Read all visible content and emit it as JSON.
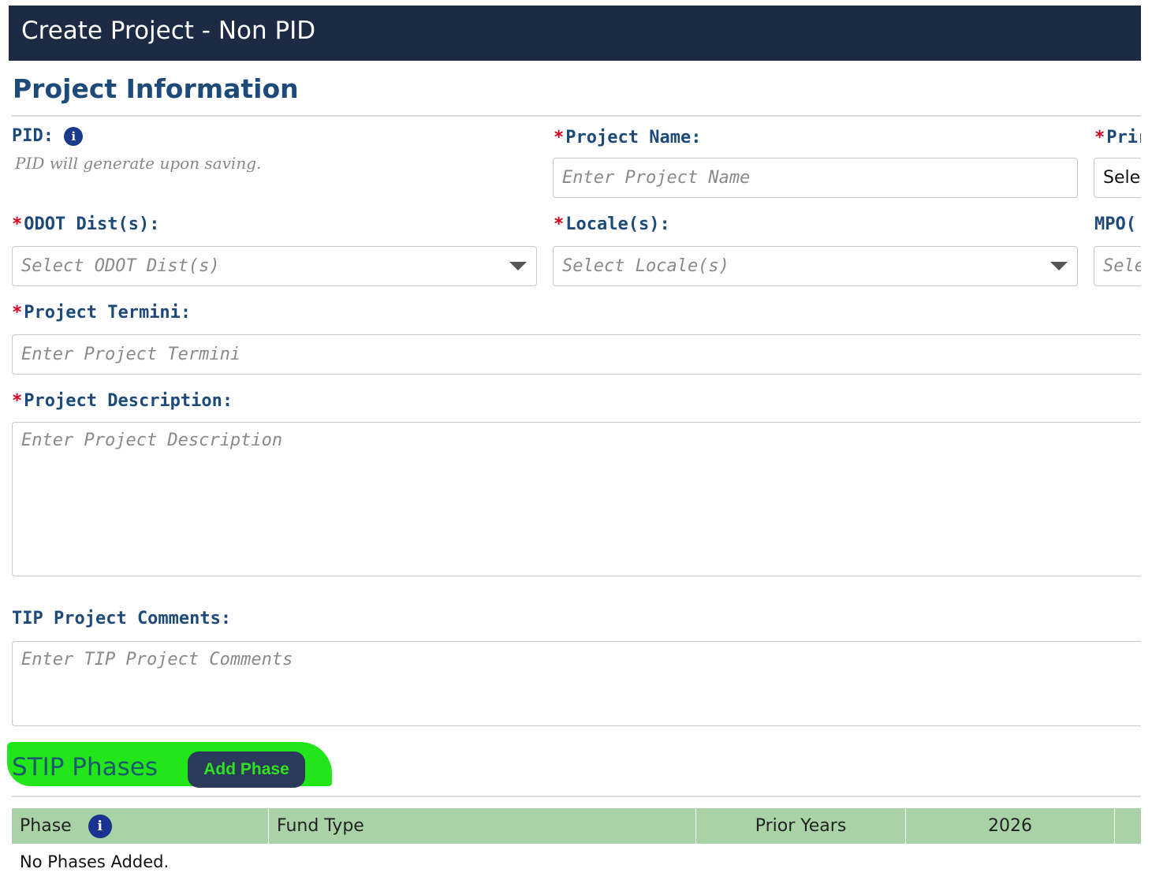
{
  "header": {
    "title": "Create Project - Non PID"
  },
  "project_info": {
    "section_title": "Project Information",
    "pid": {
      "label": "PID:",
      "hint": "PID will generate upon saving."
    },
    "project_name": {
      "label": "Project Name:",
      "placeholder": "Enter Project Name"
    },
    "prime": {
      "label_partial": "Prir",
      "value_partial": "Sele"
    },
    "odot_dists": {
      "label": "ODOT Dist(s):",
      "placeholder": "Select ODOT Dist(s)"
    },
    "locales": {
      "label": "Locale(s):",
      "placeholder": "Select Locale(s)"
    },
    "mpo": {
      "label_partial": "MPO(",
      "placeholder_partial": "Sele"
    },
    "termini": {
      "label": "Project Termini:",
      "placeholder": "Enter Project Termini"
    },
    "description": {
      "label": "Project Description:",
      "placeholder": "Enter Project Description"
    },
    "tip_comments": {
      "label": "TIP Project Comments:",
      "placeholder": "Enter TIP Project Comments"
    },
    "required_marker": "*",
    "info_glyph": "i"
  },
  "stip": {
    "title": "STIP Phases",
    "add_button": "Add Phase",
    "columns": [
      "Phase",
      "Fund Type",
      "Prior Years",
      "2026"
    ],
    "empty_message": "No Phases Added."
  },
  "colors": {
    "header_bg": "#1c2a44",
    "label_blue": "#1e4a7a",
    "required_red": "#d0021b",
    "table_header_green": "#a9d3a6",
    "highlight_green": "#22e61a",
    "button_bg": "#2a3a5a"
  },
  "icons": {
    "info": "info-circle-icon",
    "dropdown": "caret-down-icon"
  }
}
